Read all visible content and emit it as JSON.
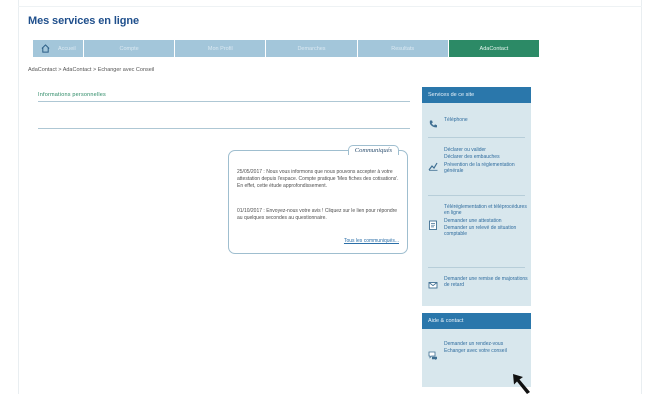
{
  "site": {
    "title": "Mes services en ligne"
  },
  "tabs": [
    {
      "label": "Accueil",
      "icon": "home-icon"
    },
    {
      "label": "Compte"
    },
    {
      "label": "Mon Profil"
    },
    {
      "label": "Demarches"
    },
    {
      "label": "Resultats"
    },
    {
      "label": "AdaContact",
      "active": true
    }
  ],
  "breadcrumb": "AdaContact > AdaContact > Echanger avec Conseil",
  "main": {
    "section_title": "Informations personnelles"
  },
  "communications": {
    "title": "Communiqués",
    "paragraph1": "25/05/2017 : Nous vous informons que nous pouvons accepter à votre attestation depuis l'espace. Compte pratique 'Mes fiches des cotisations'. En effet, cette étude approfondissement.",
    "paragraph2": "01/10/2017 : Envoyez-nous votre avis ! Cliquez sur le lien pour répondre au quelques secondes au questionnaire.",
    "link": "Tous les communiqués..."
  },
  "sidebar": {
    "panel1": {
      "title": "Services de ce site",
      "items": [
        {
          "icon": "phone-icon",
          "links": [
            "Téléphone"
          ]
        },
        {
          "icon": "chart-icon",
          "links": [
            "Déclarer ou valider",
            "Déclarer des embauches",
            "Prévention de la réglementation générale"
          ]
        },
        {
          "icon": "document-icon",
          "links": [
            "Téléréglementation et téléprocédures en ligne",
            "Demander une attestation",
            "Demander un relevé de situation comptable"
          ]
        },
        {
          "icon": "mail-icon",
          "links": [
            "Demander une remise de majorations de retard"
          ]
        }
      ]
    },
    "panel2": {
      "title": "Aide & contact",
      "items": [
        {
          "icon": "chat-icon",
          "links": [
            "Demander un rendez-vous",
            "Echanger avec votre conseil"
          ]
        }
      ]
    }
  },
  "colors": {
    "brand_title": "#1f4f8c",
    "tab_inactive": "#a3c6da",
    "tab_active": "#2c8a66",
    "side_header": "#2a77ab",
    "side_bg": "#d8e7ed",
    "link": "#2f6c9e"
  }
}
